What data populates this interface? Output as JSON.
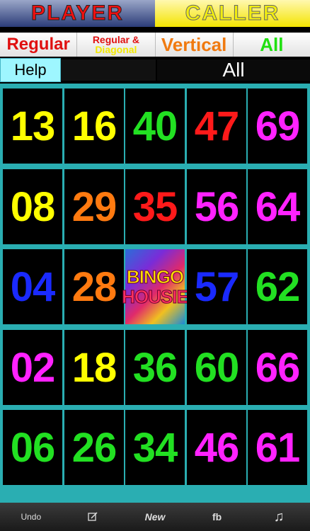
{
  "top_tabs": {
    "player": "PLAYER",
    "caller": "CALLER"
  },
  "modes": {
    "regular": "Regular",
    "regular_diagonal_line1": "Regular &",
    "regular_diagonal_line2": "Diagonal",
    "vertical": "Vertical",
    "all": "All"
  },
  "info": {
    "help": "Help",
    "selected_mode": "All"
  },
  "card": {
    "logo_line1": "BINGO",
    "logo_line2": "HOUSIE",
    "cells": [
      [
        "13",
        "16",
        "40",
        "47",
        "69"
      ],
      [
        "08",
        "29",
        "35",
        "56",
        "64"
      ],
      [
        "04",
        "28",
        "FREE",
        "57",
        "62"
      ],
      [
        "02",
        "18",
        "36",
        "60",
        "66"
      ],
      [
        "06",
        "26",
        "34",
        "46",
        "61"
      ]
    ],
    "colors": [
      [
        "#ffff00",
        "#ffff00",
        "#22e022",
        "#ff1a1a",
        "#ff22ff"
      ],
      [
        "#ffff00",
        "#ff7a10",
        "#ff1a1a",
        "#ff22ff",
        "#ff22ff"
      ],
      [
        "#1a2aff",
        "#ff7a10",
        "FREE",
        "#1a2aff",
        "#22e022"
      ],
      [
        "#ff22ff",
        "#ffff00",
        "#22e022",
        "#22e022",
        "#ff22ff"
      ],
      [
        "#22e022",
        "#22e022",
        "#22e022",
        "#ff22ff",
        "#ff22ff"
      ]
    ]
  },
  "toolbar": {
    "undo": "Undo",
    "edit_icon": "edit-icon",
    "new": "New",
    "fb": "fb",
    "music_icon": "music-note-icon",
    "music_glyph": "♫"
  }
}
